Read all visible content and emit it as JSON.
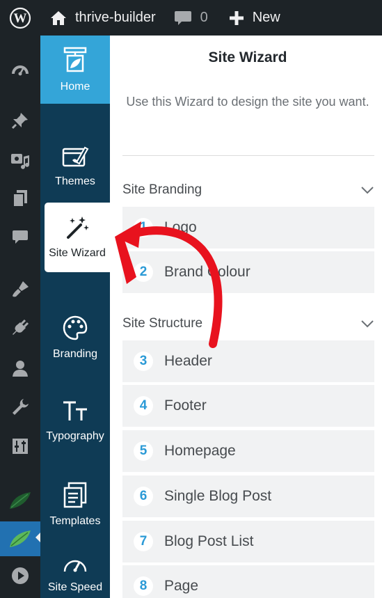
{
  "adminbar": {
    "site_name": "thrive-builder",
    "comments_count": "0",
    "new_label": "New"
  },
  "wp_menu_icons": [
    "dashboard-icon",
    "pin-icon",
    "media-icon",
    "pages-icon",
    "comments-icon",
    "appearance-icon",
    "plugins-icon",
    "users-icon",
    "tools-icon",
    "settings-icon",
    "leaf-icon",
    "leaf-icon",
    "play-icon"
  ],
  "sidebar": {
    "items": [
      {
        "label": "Home",
        "icon": "home-icon"
      },
      {
        "label": "Themes",
        "icon": "themes-icon"
      },
      {
        "label": "Site Wizard",
        "icon": "magic-wand-icon"
      },
      {
        "label": "Branding",
        "icon": "palette-icon"
      },
      {
        "label": "Typography",
        "icon": "typography-icon"
      },
      {
        "label": "Templates",
        "icon": "templates-icon"
      },
      {
        "label": "Site Speed",
        "icon": "speedometer-icon"
      }
    ]
  },
  "panel": {
    "title": "Site Wizard",
    "description": "Use this Wizard to design the site you want.",
    "sections": [
      {
        "title": "Site Branding",
        "steps": [
          {
            "num": "1",
            "label": "Logo"
          },
          {
            "num": "2",
            "label": "Brand Colour"
          }
        ]
      },
      {
        "title": "Site Structure",
        "steps": [
          {
            "num": "3",
            "label": "Header"
          },
          {
            "num": "4",
            "label": "Footer"
          },
          {
            "num": "5",
            "label": "Homepage"
          },
          {
            "num": "6",
            "label": "Single Blog Post"
          },
          {
            "num": "7",
            "label": "Blog Post List"
          },
          {
            "num": "8",
            "label": "Page"
          }
        ]
      }
    ]
  },
  "colors": {
    "admin_bg": "#1d2327",
    "sidebar_bg": "#0f3b55",
    "home_bg": "#34a5d8",
    "step_number": "#2b9ad6",
    "arrow": "#e8121e"
  }
}
